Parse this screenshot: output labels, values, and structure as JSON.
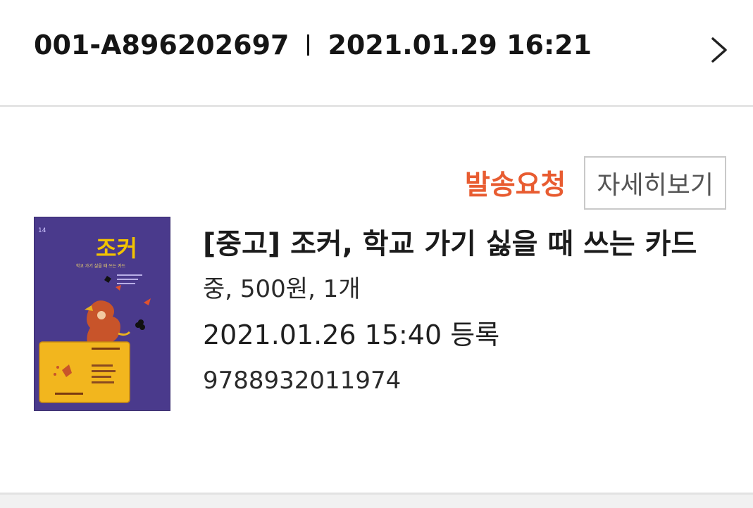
{
  "order": {
    "id": "001-A896202697",
    "datetime": "2021.01.29 16:21"
  },
  "actions": {
    "ship_request_label": "발송요청",
    "detail_label": "자세히보기"
  },
  "item": {
    "title": "[중고] 조커, 학교 가기 싫을 때 쓰는 카드",
    "meta": "중, 500원, 1개",
    "registered": "2021.01.26 15:40 등록",
    "isbn": "9788932011974",
    "cover": {
      "title_text": "조커",
      "subtitle_text": "학교 가기 싫을 때 쓰는 카드"
    }
  },
  "icons": {
    "chevron": "chevron-right-icon"
  },
  "colors": {
    "accent": "#e85c31",
    "cover_background": "#4a3a8c",
    "cover_card": "#f2b61e",
    "cover_title": "#f2c200"
  }
}
